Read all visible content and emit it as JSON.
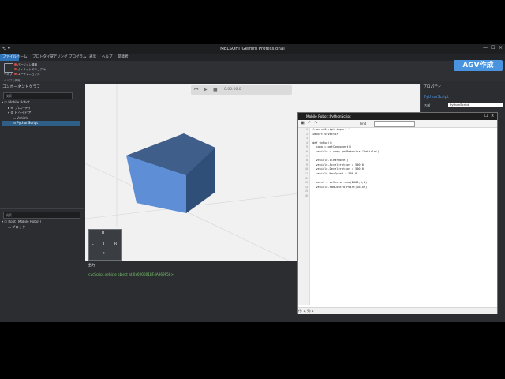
{
  "app": {
    "title": "MELSOFT Gemini Professional",
    "menu": [
      "ファイル",
      "ホーム",
      "プロトタイプ",
      "モデリング",
      "プログラム",
      "表示",
      "ヘルプ",
      "開発者"
    ],
    "active_menu_index": 0,
    "banner": "AGV作成"
  },
  "ribbon": {
    "items": [
      "バージョン情報",
      "オンラインマニュアル",
      "ユーザマニュアル"
    ],
    "help_label": "ヘルプ",
    "help_desc": "ヘルプと情報"
  },
  "panels": {
    "left_header": "コンポーネントグラフ",
    "search_placeholder": "検索",
    "tree": [
      {
        "label": "Mobile Robot",
        "level": 0
      },
      {
        "label": "プロパティ",
        "level": 1
      },
      {
        "label": "ビヘイビア",
        "level": 1
      },
      {
        "label": "Vehicle",
        "level": 2
      },
      {
        "label": "PythonScript",
        "level": 2,
        "selected": true
      }
    ],
    "lower_tree": [
      {
        "label": "Root [Mobile Robot]",
        "level": 0
      },
      {
        "label": "ブロック",
        "level": 1
      }
    ]
  },
  "right_panel": {
    "header": "プロパティ",
    "script_label": "PythonScript",
    "name_label": "名前",
    "name_value": "PythonScript"
  },
  "viewport": {
    "toolbar_time": "0:00:00.0"
  },
  "output": {
    "header": "出力",
    "text": "<vcScript.vehicle object at 0x000001BF4A969F58>"
  },
  "editor": {
    "title": "Mobile Robot::PythonScript",
    "find_label": "Find",
    "status": "行: 1, 列: 1",
    "lines": [
      "from vcScript import *",
      "import vcVector",
      "",
      "def OnRun():",
      "  comp = getComponent()",
      "  vehicle = comp.getBehavior(\"Vehicle\")",
      "",
      "  vehicle.clearMove()",
      "  vehicle.Acceleration = 500.0",
      "  vehicle.Deceleration = 500.0",
      "  vehicle.MaxSpeed = 500.0",
      "",
      "  point = vcVector.new(2000,0,0)",
      "  vehicle.addControlPoint(point)",
      "",
      ""
    ]
  },
  "navcube": {
    "labels": [
      "B",
      "L",
      "T",
      "R",
      "F"
    ]
  }
}
